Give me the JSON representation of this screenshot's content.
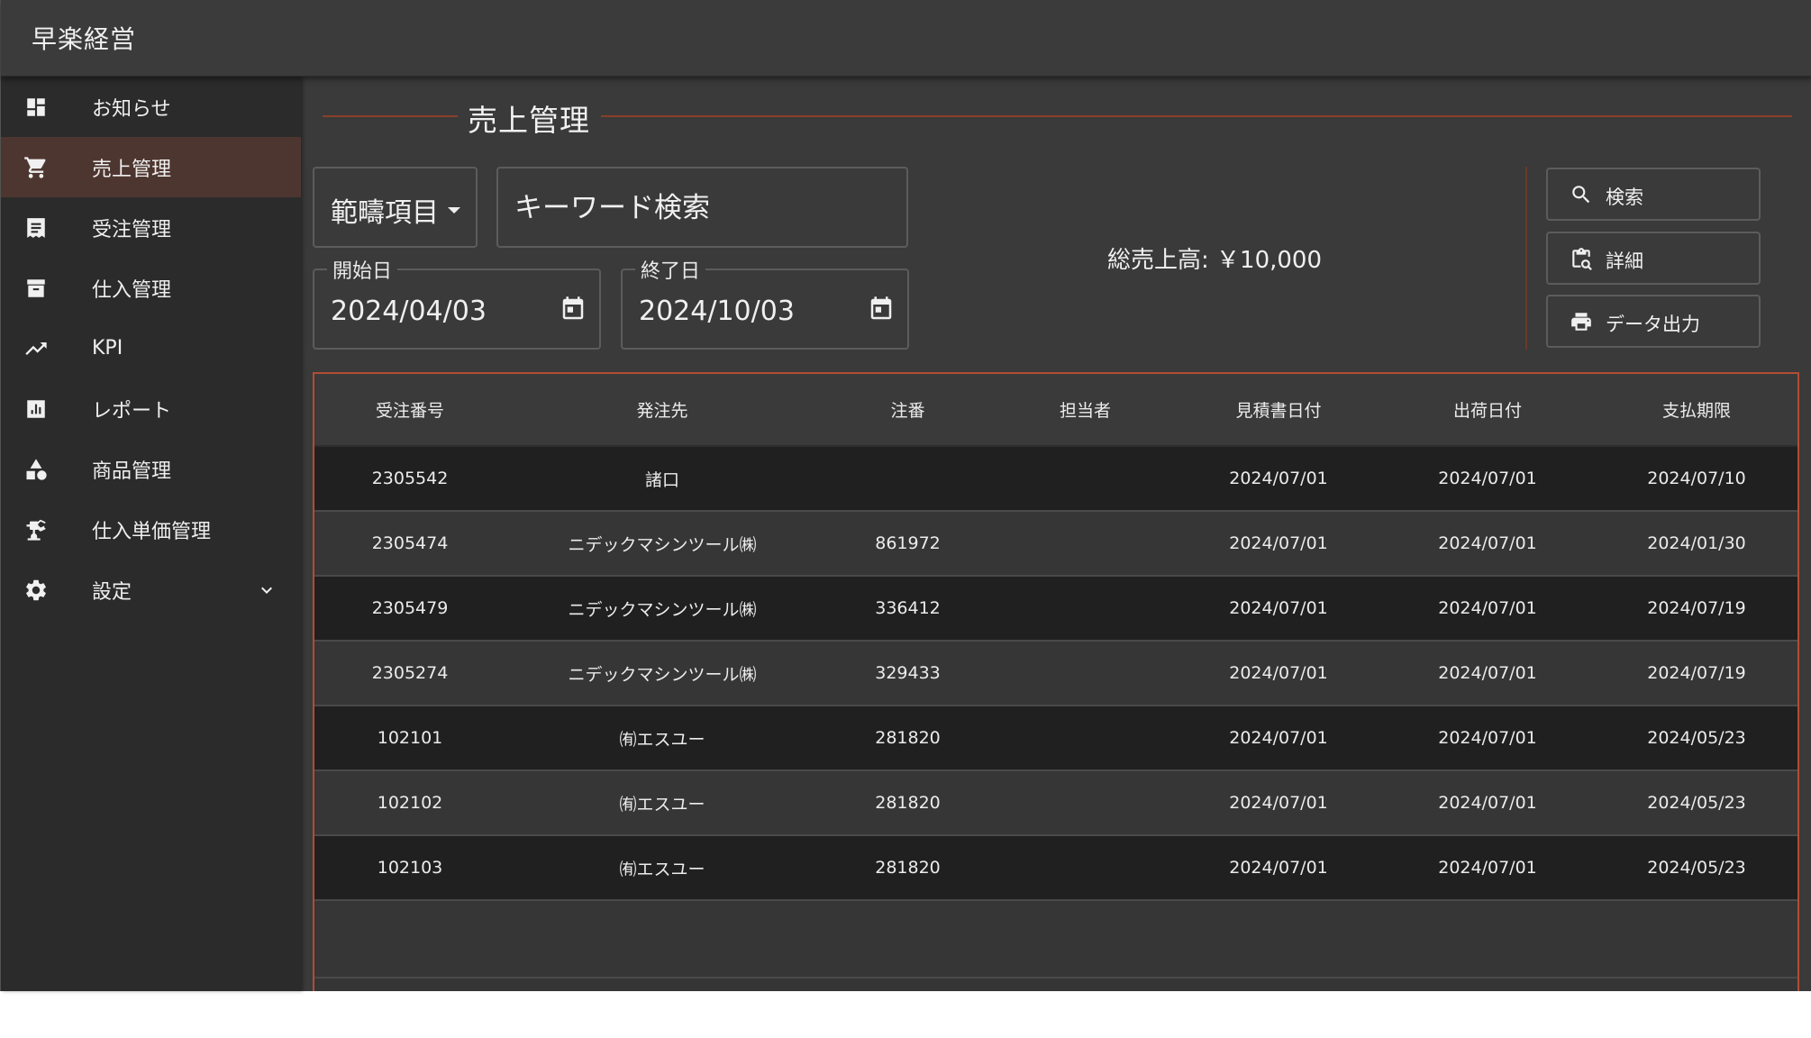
{
  "app": {
    "title": "早楽経営"
  },
  "sidebar": {
    "items": [
      {
        "label": "お知らせ",
        "icon": "dashboard-icon",
        "active": false
      },
      {
        "label": "売上管理",
        "icon": "cart-icon",
        "active": true
      },
      {
        "label": "受注管理",
        "icon": "receipt-icon",
        "active": false
      },
      {
        "label": "仕入管理",
        "icon": "archive-icon",
        "active": false
      },
      {
        "label": "KPI",
        "icon": "trending-up-icon",
        "active": false
      },
      {
        "label": "レポート",
        "icon": "bar-chart-icon",
        "active": false
      },
      {
        "label": "商品管理",
        "icon": "category-icon",
        "active": false
      },
      {
        "label": "仕入単価管理",
        "icon": "precision-tool-icon",
        "active": false
      },
      {
        "label": "設定",
        "icon": "gear-icon",
        "active": false,
        "expandable": true
      }
    ]
  },
  "main": {
    "title": "売上管理",
    "filter": {
      "select_label": "範疇項目",
      "search_placeholder": "キーワード検索",
      "start_label": "開始日",
      "start_value": "2024/04/03",
      "end_label": "終了日",
      "end_value": "2024/10/03"
    },
    "total_label": "総売上高: ￥10,000",
    "buttons": {
      "search": "検索",
      "detail": "詳細",
      "export": "データ出力"
    },
    "table": {
      "columns": [
        "受注番号",
        "発注先",
        "注番",
        "担当者",
        "見積書日付",
        "出荷日付",
        "支払期限"
      ],
      "rows": [
        [
          "2305542",
          "諸口",
          "",
          "",
          "2024/07/01",
          "2024/07/01",
          "2024/07/10"
        ],
        [
          "2305474",
          "ニデックマシンツール㈱",
          "861972",
          "",
          "2024/07/01",
          "2024/07/01",
          "2024/01/30"
        ],
        [
          "2305479",
          "ニデックマシンツール㈱",
          "336412",
          "",
          "2024/07/01",
          "2024/07/01",
          "2024/07/19"
        ],
        [
          "2305274",
          "ニデックマシンツール㈱",
          "329433",
          "",
          "2024/07/01",
          "2024/07/01",
          "2024/07/19"
        ],
        [
          "102101",
          "㈲エスユー",
          "281820",
          "",
          "2024/07/01",
          "2024/07/01",
          "2024/05/23"
        ],
        [
          "102102",
          "㈲エスユー",
          "281820",
          "",
          "2024/07/01",
          "2024/07/01",
          "2024/05/23"
        ],
        [
          "102103",
          "㈲エスユー",
          "281820",
          "",
          "2024/07/01",
          "2024/07/01",
          "2024/05/23"
        ]
      ]
    }
  },
  "colors": {
    "accent": "#b14d34",
    "active_nav": "#4e3630",
    "sidebar": "#2b2b2b",
    "background": "#3a3a3a"
  }
}
